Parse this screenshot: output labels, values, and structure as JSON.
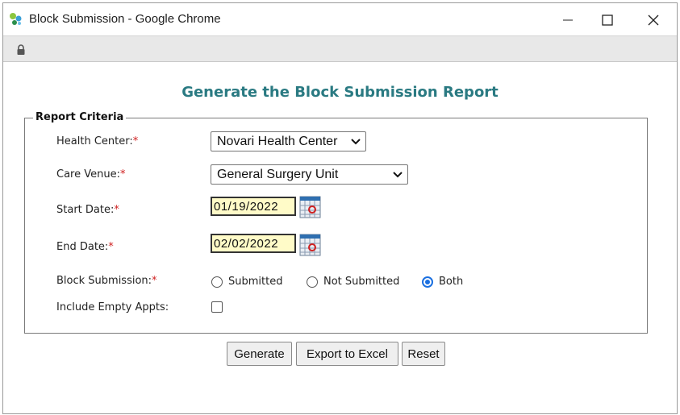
{
  "window": {
    "title": "Block Submission - Google Chrome",
    "controls": [
      "minimize",
      "maximize",
      "close"
    ]
  },
  "page": {
    "heading": "Generate the Block Submission Report",
    "heading_color": "#2a7a82"
  },
  "criteria": {
    "legend": "Report Criteria",
    "required_mark": "*",
    "health_center": {
      "label": "Health Center:",
      "value": "Novari Health Center"
    },
    "care_venue": {
      "label": "Care Venue:",
      "value": "General Surgery Unit"
    },
    "start_date": {
      "label": "Start Date:",
      "value": "01/19/2022"
    },
    "end_date": {
      "label": "End Date:",
      "value": "02/02/2022"
    },
    "block_submission": {
      "label": "Block Submission:",
      "options": [
        "Submitted",
        "Not Submitted",
        "Both"
      ],
      "selected": "Both"
    },
    "include_empty": {
      "label": "Include Empty Appts:",
      "checked": false
    }
  },
  "actions": {
    "generate": "Generate",
    "export": "Export to Excel",
    "reset": "Reset"
  },
  "colors": {
    "date_bg": "#fffbc8",
    "required": "#d02020",
    "radio_selected": "#1a6fe0"
  }
}
